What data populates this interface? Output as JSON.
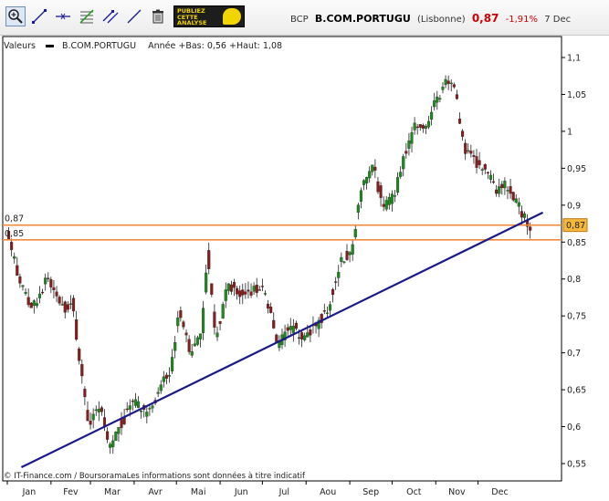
{
  "toolbar": {
    "tools": [
      {
        "name": "zoom-tool",
        "icon": "zoom-in-icon"
      },
      {
        "name": "trendline-tool",
        "icon": "trendline-icon"
      },
      {
        "name": "horizontal-line-tool",
        "icon": "horizontal-line-icon"
      },
      {
        "name": "fibonacci-tool",
        "icon": "fibonacci-icon"
      },
      {
        "name": "channel-tool",
        "icon": "channel-icon"
      },
      {
        "name": "parallel-line-tool",
        "icon": "parallel-line-icon"
      },
      {
        "name": "delete-tool",
        "icon": "trash-icon"
      }
    ],
    "ad_text": "PUBLIEZ\nCETTE\nANALYSE"
  },
  "header": {
    "code": "BCP",
    "name": "B.COM.PORTUGU",
    "market": "(Lisbonne)",
    "price": "0,87",
    "change": "-1,91%",
    "date": "7 Dec",
    "change_color": "#d00000"
  },
  "legend": {
    "label": "Valeurs",
    "series": "B.COM.PORTUGU",
    "range_text": "Année +Bas: 0,56 +Haut: 1,08"
  },
  "copyright": "© IT-Finance.com / BoursoramaLes informations sont données à titre indicatif",
  "chart_data": {
    "type": "candlestick",
    "x_labels": [
      "Jan",
      "Fev",
      "Mar",
      "Avr",
      "Mai",
      "Jun",
      "Jul",
      "Aou",
      "Sep",
      "Oct",
      "Nov",
      "Dec"
    ],
    "y_ticks": [
      "0,55",
      "0,6",
      "0,65",
      "0,7",
      "0,75",
      "0,8",
      "0,85",
      "0,9",
      "0,95",
      "1",
      "1,05",
      "1,1"
    ],
    "ylim": [
      0.55,
      1.1
    ],
    "grid": false,
    "last_price_label": "0,87",
    "level_labels": [
      "0,87",
      "0,85"
    ],
    "hlines": [
      {
        "value": 0.873,
        "color": "#f08a3c"
      },
      {
        "value": 0.853,
        "color": "#f08a3c"
      }
    ],
    "trendline": {
      "from": {
        "day": 10,
        "value": 0.545
      },
      "to": {
        "day": 380,
        "value": 0.89
      },
      "color": "#1a1a8c"
    },
    "anchors": [
      {
        "day": 0,
        "value": 0.86
      },
      {
        "day": 10,
        "value": 0.79
      },
      {
        "day": 18,
        "value": 0.76
      },
      {
        "day": 28,
        "value": 0.8
      },
      {
        "day": 40,
        "value": 0.76
      },
      {
        "day": 46,
        "value": 0.77
      },
      {
        "day": 52,
        "value": 0.68
      },
      {
        "day": 58,
        "value": 0.6
      },
      {
        "day": 66,
        "value": 0.63
      },
      {
        "day": 72,
        "value": 0.57
      },
      {
        "day": 80,
        "value": 0.6
      },
      {
        "day": 90,
        "value": 0.635
      },
      {
        "day": 100,
        "value": 0.62
      },
      {
        "day": 108,
        "value": 0.65
      },
      {
        "day": 116,
        "value": 0.68
      },
      {
        "day": 122,
        "value": 0.76
      },
      {
        "day": 130,
        "value": 0.7
      },
      {
        "day": 138,
        "value": 0.73
      },
      {
        "day": 142,
        "value": 0.84
      },
      {
        "day": 148,
        "value": 0.72
      },
      {
        "day": 156,
        "value": 0.79
      },
      {
        "day": 168,
        "value": 0.78
      },
      {
        "day": 180,
        "value": 0.79
      },
      {
        "day": 186,
        "value": 0.76
      },
      {
        "day": 192,
        "value": 0.71
      },
      {
        "day": 200,
        "value": 0.735
      },
      {
        "day": 210,
        "value": 0.72
      },
      {
        "day": 220,
        "value": 0.74
      },
      {
        "day": 228,
        "value": 0.76
      },
      {
        "day": 236,
        "value": 0.82
      },
      {
        "day": 244,
        "value": 0.84
      },
      {
        "day": 252,
        "value": 0.93
      },
      {
        "day": 260,
        "value": 0.95
      },
      {
        "day": 266,
        "value": 0.9
      },
      {
        "day": 274,
        "value": 0.91
      },
      {
        "day": 282,
        "value": 0.97
      },
      {
        "day": 290,
        "value": 1.01
      },
      {
        "day": 296,
        "value": 1.0
      },
      {
        "day": 304,
        "value": 1.04
      },
      {
        "day": 312,
        "value": 1.07
      },
      {
        "day": 318,
        "value": 1.05
      },
      {
        "day": 324,
        "value": 0.98
      },
      {
        "day": 330,
        "value": 0.96
      },
      {
        "day": 340,
        "value": 0.95
      },
      {
        "day": 346,
        "value": 0.92
      },
      {
        "day": 352,
        "value": 0.93
      },
      {
        "day": 360,
        "value": 0.91
      },
      {
        "day": 366,
        "value": 0.885
      },
      {
        "day": 371,
        "value": 0.87
      }
    ]
  }
}
